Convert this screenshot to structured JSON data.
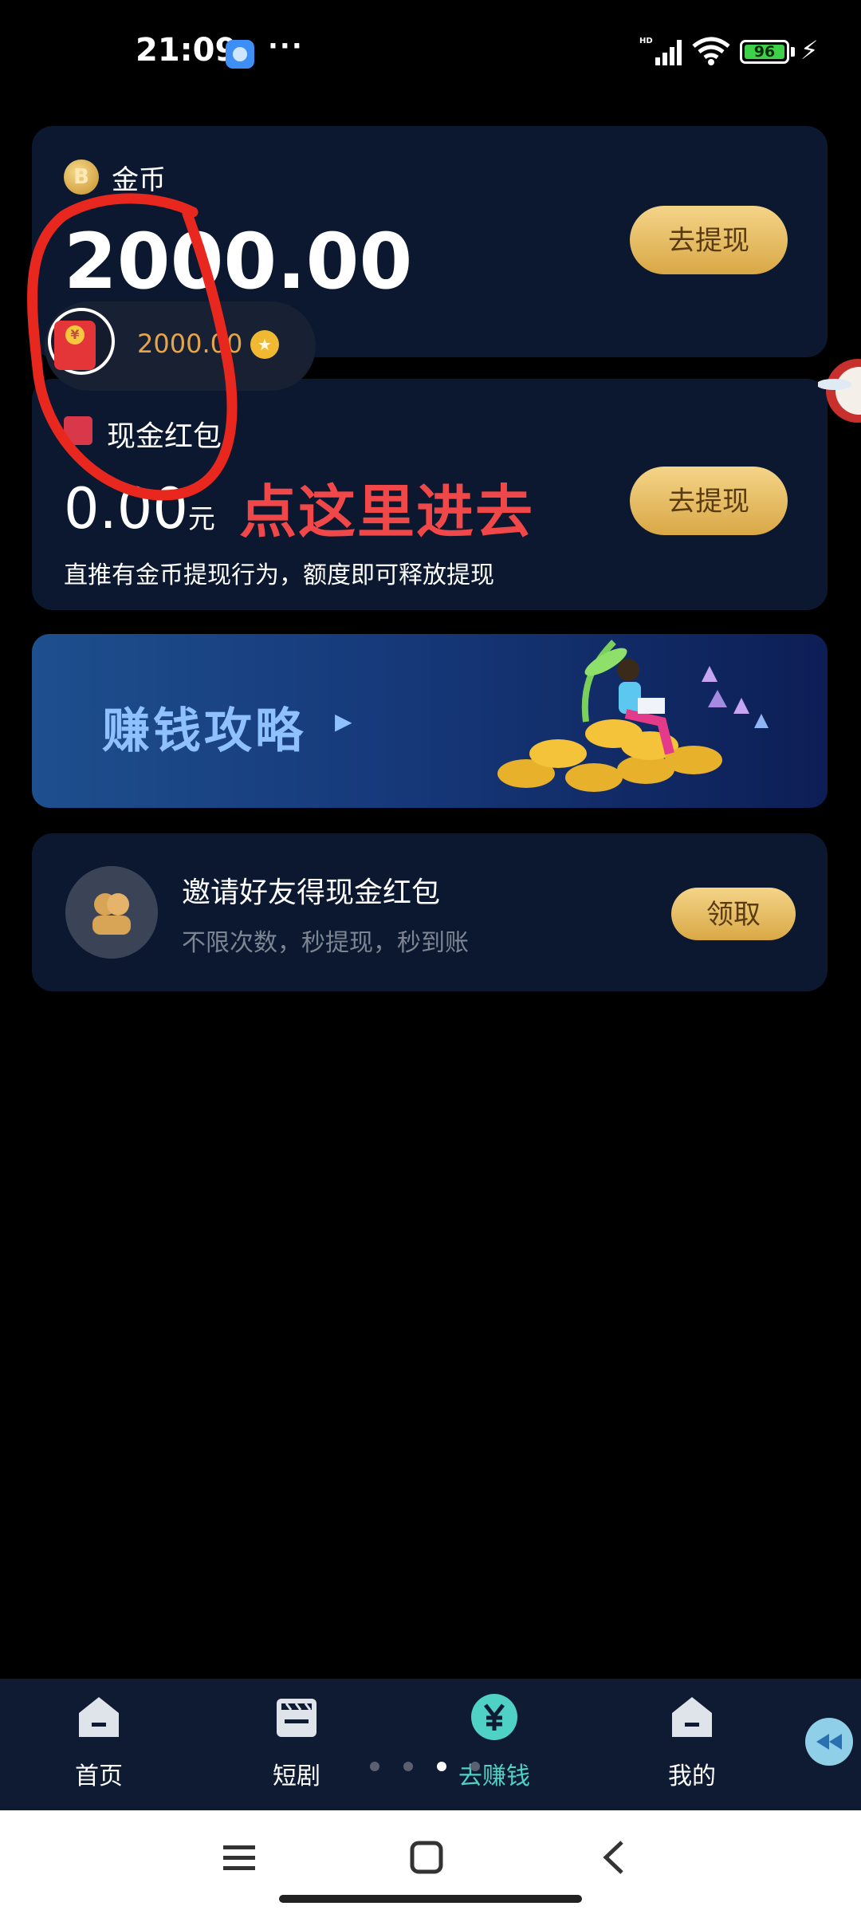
{
  "status_bar": {
    "time": "21:09",
    "dots": "···",
    "battery": "96",
    "network": "HD"
  },
  "coin_card": {
    "title": "金币",
    "amount": "2000.00",
    "withdraw_label": "去提现"
  },
  "floating_widget": {
    "amount": "2000.00"
  },
  "cash_card": {
    "title": "现金红包",
    "amount": "0.00",
    "unit": "元",
    "withdraw_label": "去提现",
    "description": "直推有金币提现行为，额度即可释放提现"
  },
  "annotation": {
    "text": "点这里进去",
    "color": "#f04848"
  },
  "banner": {
    "title": "赚钱攻略"
  },
  "invite": {
    "title": "邀请好友得现金红包",
    "subtitle": "不限次数，秒提现，秒到账",
    "button_label": "领取"
  },
  "bottom_nav": {
    "items": [
      {
        "label": "首页",
        "icon": "home-icon"
      },
      {
        "label": "短剧",
        "icon": "clapperboard-icon"
      },
      {
        "label": "去赚钱",
        "icon": "yuan-icon",
        "active": true
      },
      {
        "label": "我的",
        "icon": "profile-icon"
      }
    ],
    "page_dots": 4,
    "active_dot": 3
  },
  "system_nav": {
    "menu_icon": "menu-icon",
    "home_icon": "square-home-icon",
    "back_icon": "back-icon"
  },
  "colors": {
    "card_bg": "#0b1830",
    "gold": "#e5b65a",
    "active_nav": "#4fd1c5"
  }
}
